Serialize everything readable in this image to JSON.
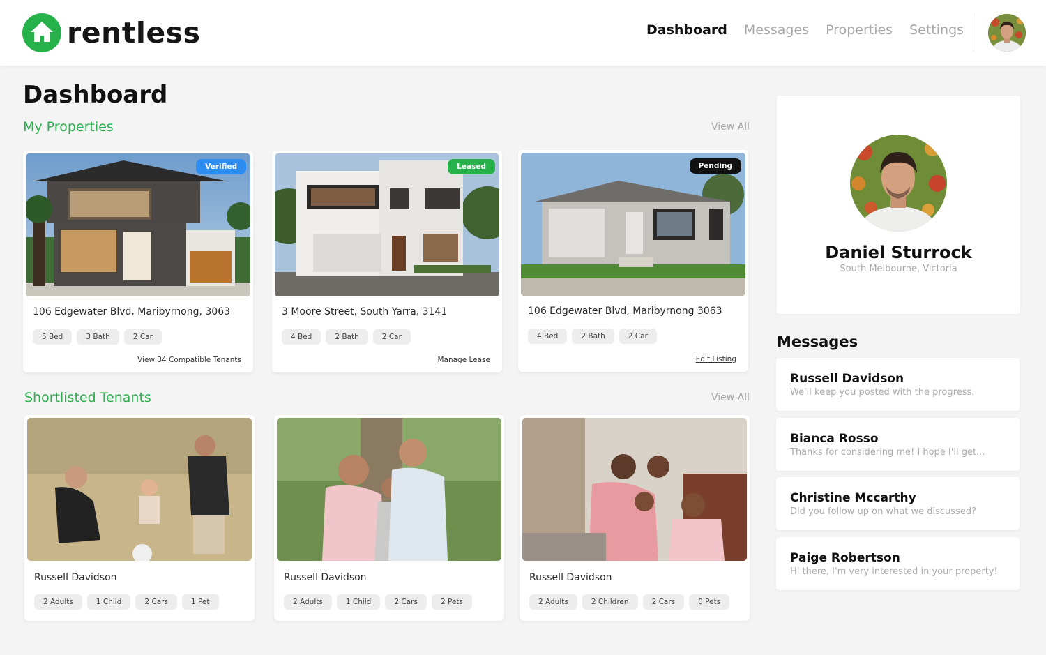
{
  "brand": {
    "name": "rentless",
    "accent": "#27b14b"
  },
  "nav": {
    "items": [
      "Dashboard",
      "Messages",
      "Properties",
      "Settings"
    ],
    "active": "Dashboard"
  },
  "page": {
    "title": "Dashboard"
  },
  "properties": {
    "heading": "My Properties",
    "view_all": "View All",
    "items": [
      {
        "status": "Verified",
        "status_color": "#2d8cf0",
        "address": "106 Edgewater Blvd, Maribyrnong, 3063",
        "features": [
          "5 Bed",
          "3 Bath",
          "2 Car"
        ],
        "link": "View 34 Compatible Tenants"
      },
      {
        "status": "Leased",
        "status_color": "#27b14b",
        "address": "3 Moore Street, South Yarra, 3141",
        "features": [
          "4 Bed",
          "2 Bath",
          "2 Car"
        ],
        "link": "Manage Lease"
      },
      {
        "status": "Pending",
        "status_color": "#111111",
        "address": "106 Edgewater Blvd, Maribyrnong 3063",
        "features": [
          "4 Bed",
          "2 Bath",
          "2 Car"
        ],
        "link": "Edit Listing"
      }
    ]
  },
  "tenants": {
    "heading": "Shortlisted Tenants",
    "view_all": "View All",
    "items": [
      {
        "name": "Russell Davidson",
        "tags": [
          "2 Adults",
          "1 Child",
          "2 Cars",
          "1 Pet"
        ]
      },
      {
        "name": "Russell Davidson",
        "tags": [
          "2 Adults",
          "1 Child",
          "2 Cars",
          "2 Pets"
        ]
      },
      {
        "name": "Russell Davidson",
        "tags": [
          "2 Adults",
          "2 Children",
          "2 Cars",
          "0 Pets"
        ]
      }
    ]
  },
  "profile": {
    "name": "Daniel Sturrock",
    "location": "South Melbourne, Victoria"
  },
  "messages": {
    "heading": "Messages",
    "items": [
      {
        "name": "Russell Davidson",
        "preview": "We'll keep you posted with the progress."
      },
      {
        "name": "Bianca Rosso",
        "preview": "Thanks for considering me! I hope I'll get..."
      },
      {
        "name": "Christine Mccarthy",
        "preview": "Did you follow up on what we discussed?"
      },
      {
        "name": "Paige Robertson",
        "preview": "Hi there, I'm very interested in your property!"
      }
    ]
  }
}
